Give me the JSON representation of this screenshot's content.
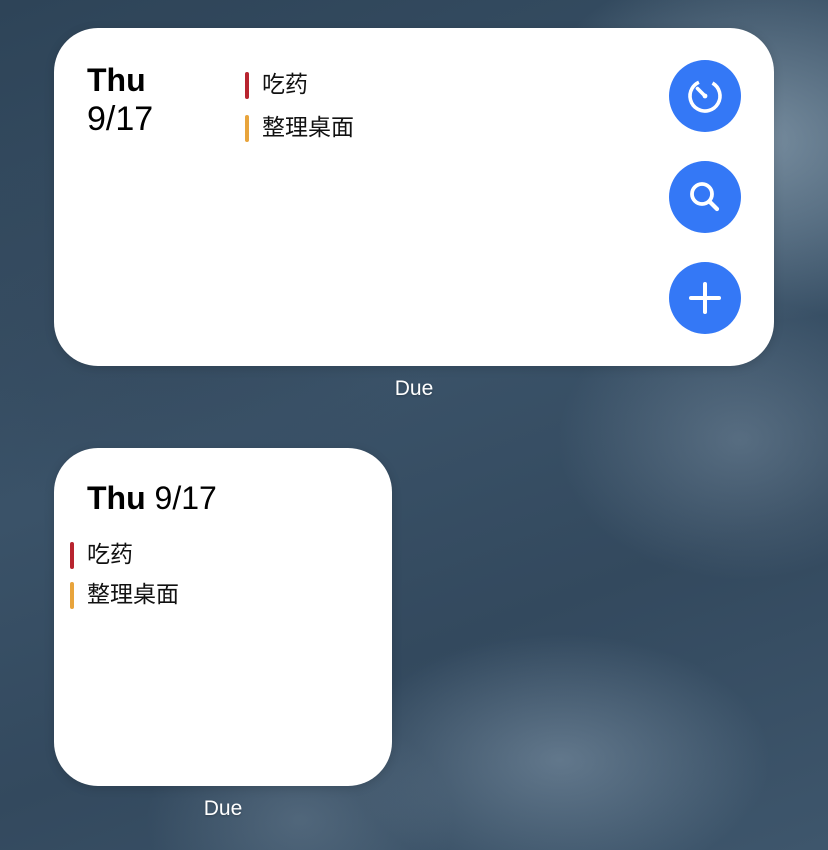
{
  "colors": {
    "accent_blue": "#3478f6",
    "priority_high": "#b8242f",
    "priority_medium": "#e8a43c",
    "widget_bg": "#ffffff"
  },
  "widget_medium": {
    "day": "Thu",
    "date": "9/17",
    "tasks": [
      {
        "title": "吃药",
        "priority_color": "#b8242f"
      },
      {
        "title": "整理桌面",
        "priority_color": "#e8a43c"
      }
    ],
    "buttons": [
      {
        "icon": "timer-icon"
      },
      {
        "icon": "search-icon"
      },
      {
        "icon": "plus-icon"
      }
    ],
    "label": "Due"
  },
  "widget_small": {
    "day": "Thu",
    "date": "9/17",
    "tasks": [
      {
        "title": "吃药",
        "priority_color": "#b8242f"
      },
      {
        "title": "整理桌面",
        "priority_color": "#e8a43c"
      }
    ],
    "label": "Due"
  }
}
